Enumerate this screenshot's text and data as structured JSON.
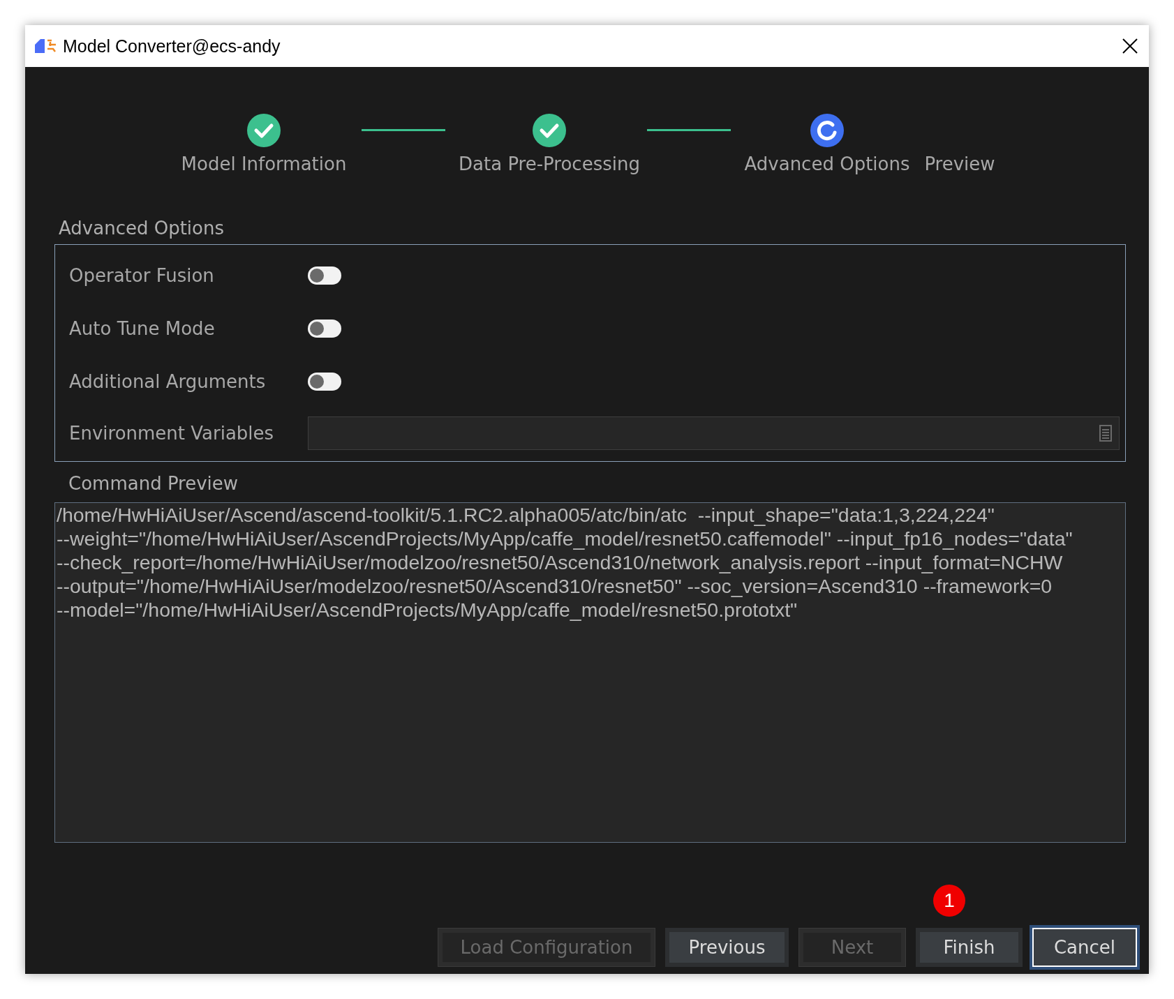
{
  "window": {
    "title": "Model Converter@ecs-andy"
  },
  "steps": [
    {
      "label": "Model Information",
      "completed": true,
      "current": false
    },
    {
      "label": "Data Pre-Processing",
      "completed": true,
      "current": false
    },
    {
      "label": "Advanced Options",
      "completed": false,
      "current": true
    },
    {
      "label": "Preview",
      "completed": false,
      "current": false
    }
  ],
  "section_title": "Advanced Options",
  "options": [
    {
      "kind": "toggle",
      "label": "Operator Fusion",
      "on": false
    },
    {
      "kind": "toggle",
      "label": "Auto Tune Mode",
      "on": false
    },
    {
      "kind": "toggle",
      "label": "Additional Arguments",
      "on": false
    },
    {
      "kind": "field",
      "label": "Environment Variables"
    }
  ],
  "command_preview": {
    "title": "Command Preview",
    "lines": [
      "/home/HwHiAiUser/Ascend/ascend-toolkit/5.1.RC2.alpha005/atc/bin/atc  --input_shape=\"data:1,3,224,224\"",
      "--weight=\"/home/HwHiAiUser/AscendProjects/MyApp/caffe_model/resnet50.caffemodel\" --input_fp16_nodes=\"data\"",
      "--check_report=/home/HwHiAiUser/modelzoo/resnet50/Ascend310/network_analysis.report --input_format=NCHW",
      "--output=\"/home/HwHiAiUser/modelzoo/resnet50/Ascend310/resnet50\" --soc_version=Ascend310 --framework=0",
      "--model=\"/home/HwHiAiUser/AscendProjects/MyApp/caffe_model/resnet50.prototxt\""
    ]
  },
  "annotation_badge": "1",
  "buttons": [
    {
      "label": "Load Configuration",
      "disabled": true,
      "focused": false
    },
    {
      "label": "Previous",
      "disabled": false,
      "focused": false
    },
    {
      "label": "Next",
      "disabled": true,
      "focused": false
    },
    {
      "label": "Finish",
      "disabled": false,
      "focused": false
    },
    {
      "label": "Cancel",
      "disabled": false,
      "focused": true
    }
  ]
}
